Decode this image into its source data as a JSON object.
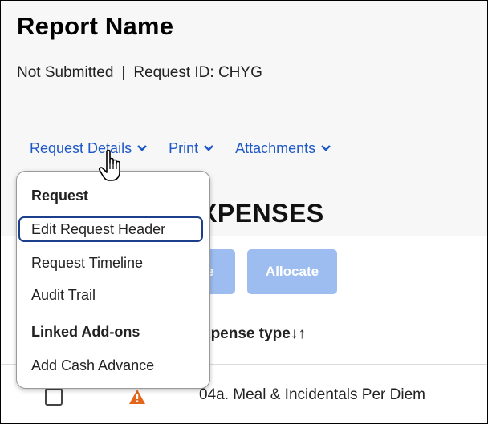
{
  "report": {
    "title": "Report Name",
    "status": "Not Submitted",
    "separator": "|",
    "request_id": "Request ID: CHYG"
  },
  "nav": {
    "items": [
      {
        "label": "Request Details"
      },
      {
        "label": "Print"
      },
      {
        "label": "Attachments"
      }
    ]
  },
  "menu": {
    "sections": [
      {
        "heading": "Request",
        "items": [
          "Edit Request Header",
          "Request Timeline",
          "Audit Trail"
        ]
      },
      {
        "heading": "Linked Add-ons",
        "items": [
          "Add Cash Advance"
        ]
      }
    ]
  },
  "expenses": {
    "section_title": "XPENSES",
    "buttons": {
      "partial_label": "te",
      "allocate_label": "Allocate"
    },
    "column_header": "xpense type↓↑",
    "rows": [
      {
        "expense": "04a. Meal & Incidentals Per Diem",
        "warning": true
      }
    ]
  },
  "colors": {
    "link": "#1f58c7",
    "button_disabled": "#9dbdf0",
    "warning": "#e5661a",
    "focus_ring": "#1b3f8a"
  },
  "icons": [
    "chevron-down-icon",
    "warning-icon",
    "hand-pointer-cursor-icon"
  ]
}
